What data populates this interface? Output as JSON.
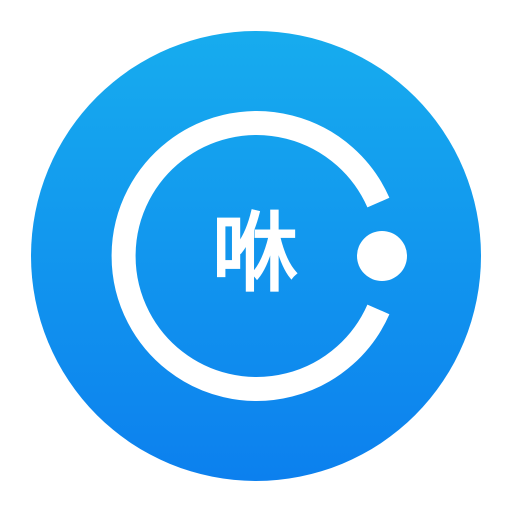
{
  "icon": {
    "character": "咻",
    "colors": {
      "circle_top": "#17ACEE",
      "circle_bottom": "#0C80EE",
      "foreground": "#FFFFFF",
      "background": "#FFFFFF"
    },
    "shapes": [
      "c-ring",
      "dot"
    ]
  }
}
